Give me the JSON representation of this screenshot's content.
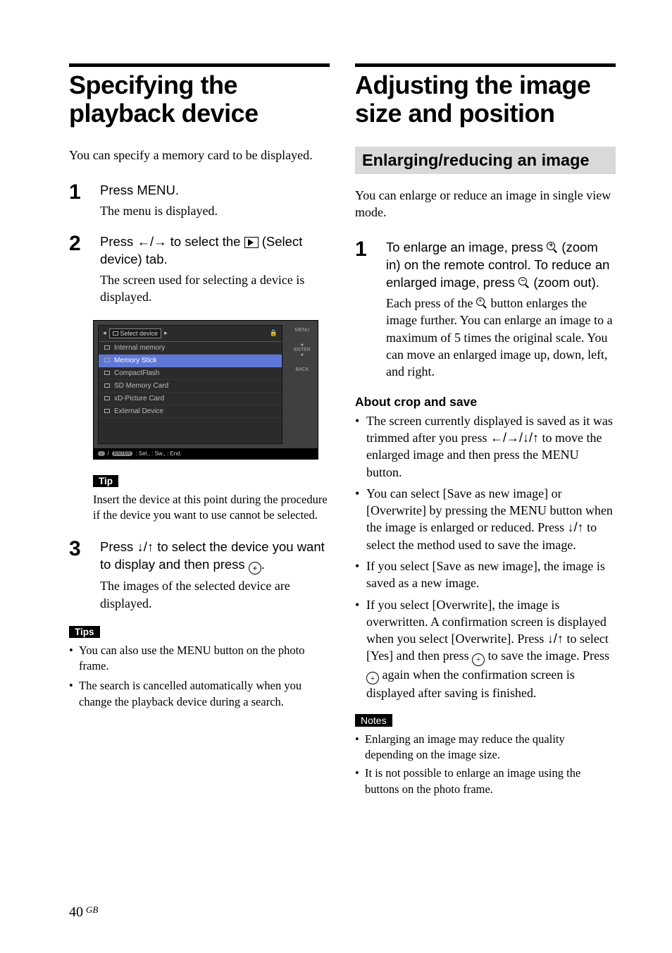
{
  "left": {
    "title": "Specifying the playback device",
    "intro": "You can specify a memory card to be displayed.",
    "steps": [
      {
        "num": "1",
        "instr": "Press MENU.",
        "result": "The menu is displayed."
      },
      {
        "num": "2",
        "instr_pre": "Press ",
        "instr_arrows": "B/b",
        "instr_mid": " to select the ",
        "instr_post": " (Select device) tab.",
        "result": "The screen used for selecting a device is displayed."
      },
      {
        "num": "3",
        "instr_pre": "Press ",
        "instr_arrows": "v/V",
        "instr_mid": " to select the device you want to display and then press ",
        "instr_post": ".",
        "result": "The images of the selected device are displayed."
      }
    ],
    "tip_label": "Tip",
    "tip_text": "Insert the device at this point during the procedure if the device you want to use cannot be selected.",
    "tips_label": "Tips",
    "tips": [
      "You can also use the MENU button on the photo frame.",
      "The search is cancelled automatically when you change the playback device during a search."
    ]
  },
  "screenshot": {
    "tab_title": "Select device",
    "items": [
      "Internal memory",
      "Memory Stick",
      "CompactFlash",
      "SD Memory Card",
      "xD-Picture Card",
      "External Device"
    ],
    "side": [
      "MENU",
      "ENTER",
      "BACK"
    ],
    "foot": ": Sel.,          : Sw.,           : End."
  },
  "right": {
    "title": "Adjusting the image size and position",
    "h2": "Enlarging/reducing an image",
    "intro": "You can enlarge or reduce an image in single view mode.",
    "step1": {
      "num": "1",
      "instr_a": "To enlarge an image, press ",
      "instr_b": " (zoom in) on the remote control. To reduce an enlarged image, press ",
      "instr_c": " (zoom out).",
      "result_a": "Each press of the ",
      "result_b": " button enlarges the image further. You can enlarge an image to a maximum of 5 times the original scale. You can move an enlarged image up, down, left, and right."
    },
    "subhead": "About crop and save",
    "bullets": [
      {
        "pre": "The screen currently displayed is saved as it was trimmed after you press ",
        "arr": "B/b/v/V",
        "post": " to move the enlarged image and then press the MENU button."
      },
      {
        "pre": "You can select [Save as new image] or [Overwrite] by pressing the MENU button when the image is enlarged or reduced. Press ",
        "arr": "v/V",
        "post": " to select the method used to save the image."
      },
      {
        "pre": "If you select [Save as new image], the image is saved as a new image.",
        "arr": "",
        "post": ""
      },
      {
        "pre": "If you select [Overwrite], the image is overwritten. A confirmation screen is displayed when you select [Overwrite]. Press ",
        "arr": "v/V",
        "mid": " to select [Yes] and then press ",
        " circle": true,
        "aft": " to save the image. Press ",
        "aft2": " again when the confirmation screen is displayed after saving is finished."
      }
    ],
    "notes_label": "Notes",
    "notes": [
      "Enlarging an image may reduce the quality depending on the image size.",
      "It is not possible to enlarge an image using the buttons on the photo frame."
    ]
  },
  "footer": {
    "page": "40",
    "region": "GB"
  }
}
